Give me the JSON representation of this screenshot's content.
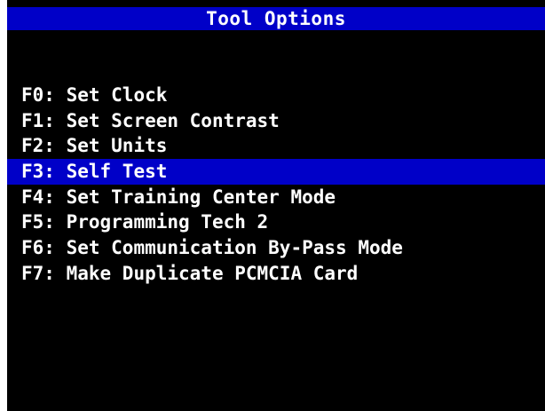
{
  "screen": {
    "title": "Tool Options"
  },
  "menu": {
    "selected_index": 3,
    "items": [
      {
        "key": "F0:",
        "label": "Set Clock"
      },
      {
        "key": "F1:",
        "label": "Set Screen Contrast"
      },
      {
        "key": "F2:",
        "label": "Set Units"
      },
      {
        "key": "F3:",
        "label": "Self Test"
      },
      {
        "key": "F4:",
        "label": "Set Training Center Mode"
      },
      {
        "key": "F5:",
        "label": "Programming Tech 2"
      },
      {
        "key": "F6:",
        "label": "Set Communication By-Pass Mode"
      },
      {
        "key": "F7:",
        "label": "Make Duplicate PCMCIA Card"
      }
    ]
  },
  "colors": {
    "background": "#000000",
    "highlight": "#0000c8",
    "text": "#ffffff"
  }
}
